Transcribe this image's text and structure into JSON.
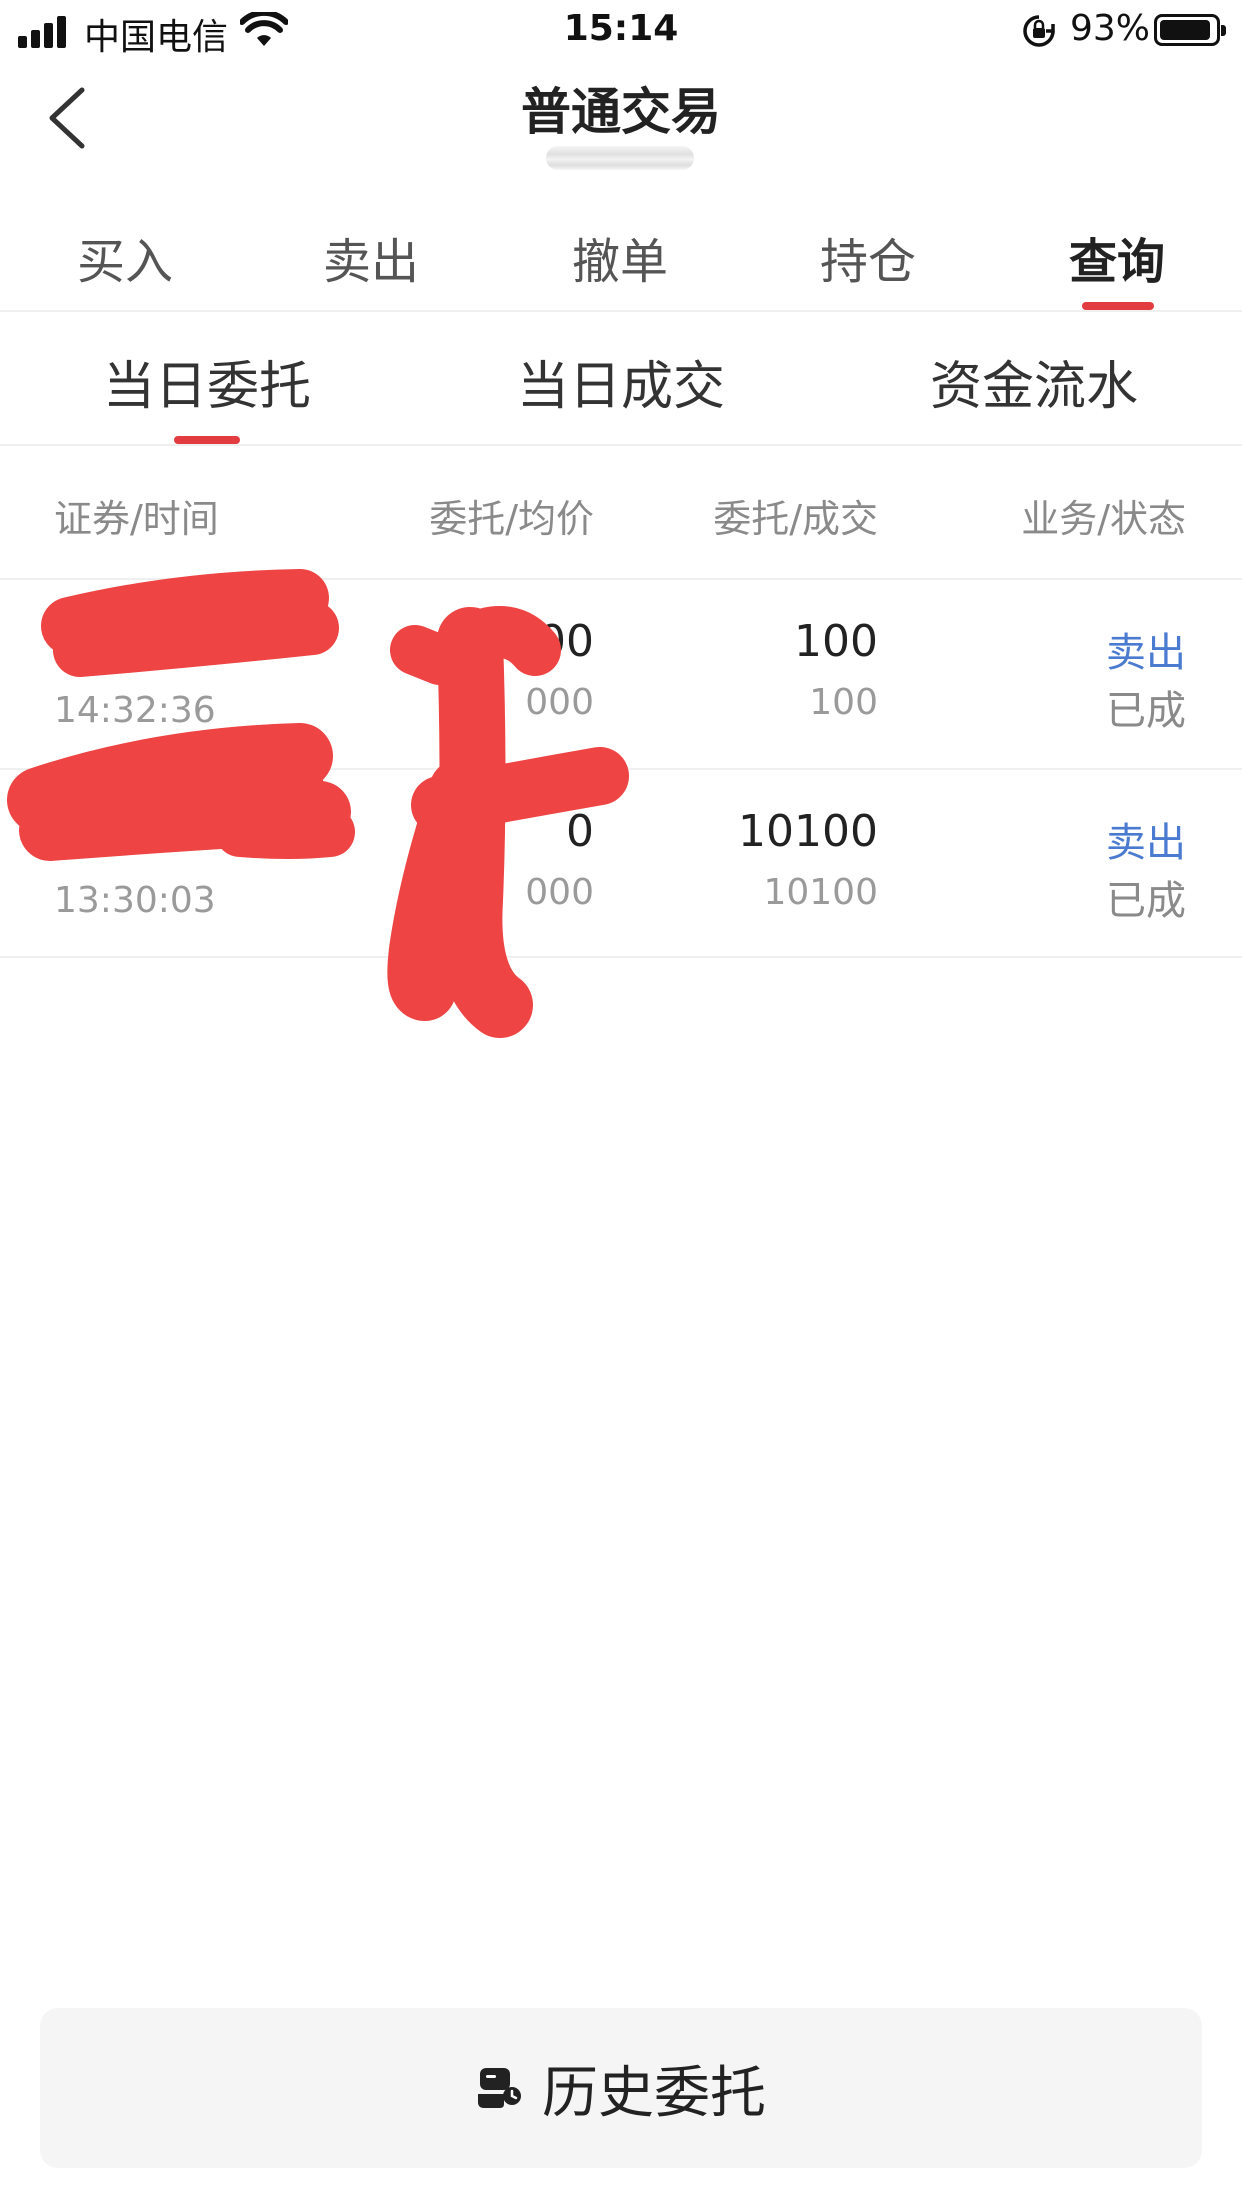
{
  "status_bar": {
    "carrier": "中国电信",
    "time": "15:14",
    "battery": "93%",
    "battery_level": 0.93
  },
  "nav": {
    "title": "普通交易"
  },
  "top_tabs": [
    {
      "label": "买入",
      "active": false
    },
    {
      "label": "卖出",
      "active": false
    },
    {
      "label": "撤单",
      "active": false
    },
    {
      "label": "持仓",
      "active": false
    },
    {
      "label": "查询",
      "active": true
    }
  ],
  "sub_tabs": [
    {
      "label": "当日委托",
      "active": true
    },
    {
      "label": "当日成交",
      "active": false
    },
    {
      "label": "资金流水",
      "active": false
    }
  ],
  "table": {
    "headers": [
      "证券/时间",
      "委托/均价",
      "委托/成交",
      "业务/状态"
    ],
    "rows": [
      {
        "security": "",
        "time": "14:32:36",
        "order_price_partial": "00",
        "avg_price_partial": "000",
        "order_qty": "100",
        "filled_qty": "100",
        "operation": "卖出",
        "status": "已成"
      },
      {
        "security": "",
        "time": "13:30:03",
        "order_price_partial": "0",
        "avg_price_partial": "000",
        "order_qty": "10100",
        "filled_qty": "10100",
        "operation": "卖出",
        "status": "已成"
      }
    ]
  },
  "footer": {
    "history_label": "历史委托"
  },
  "colors": {
    "accent_red": "#e23b40",
    "link_blue": "#4b7bd0",
    "redaction": "#ee4444"
  }
}
